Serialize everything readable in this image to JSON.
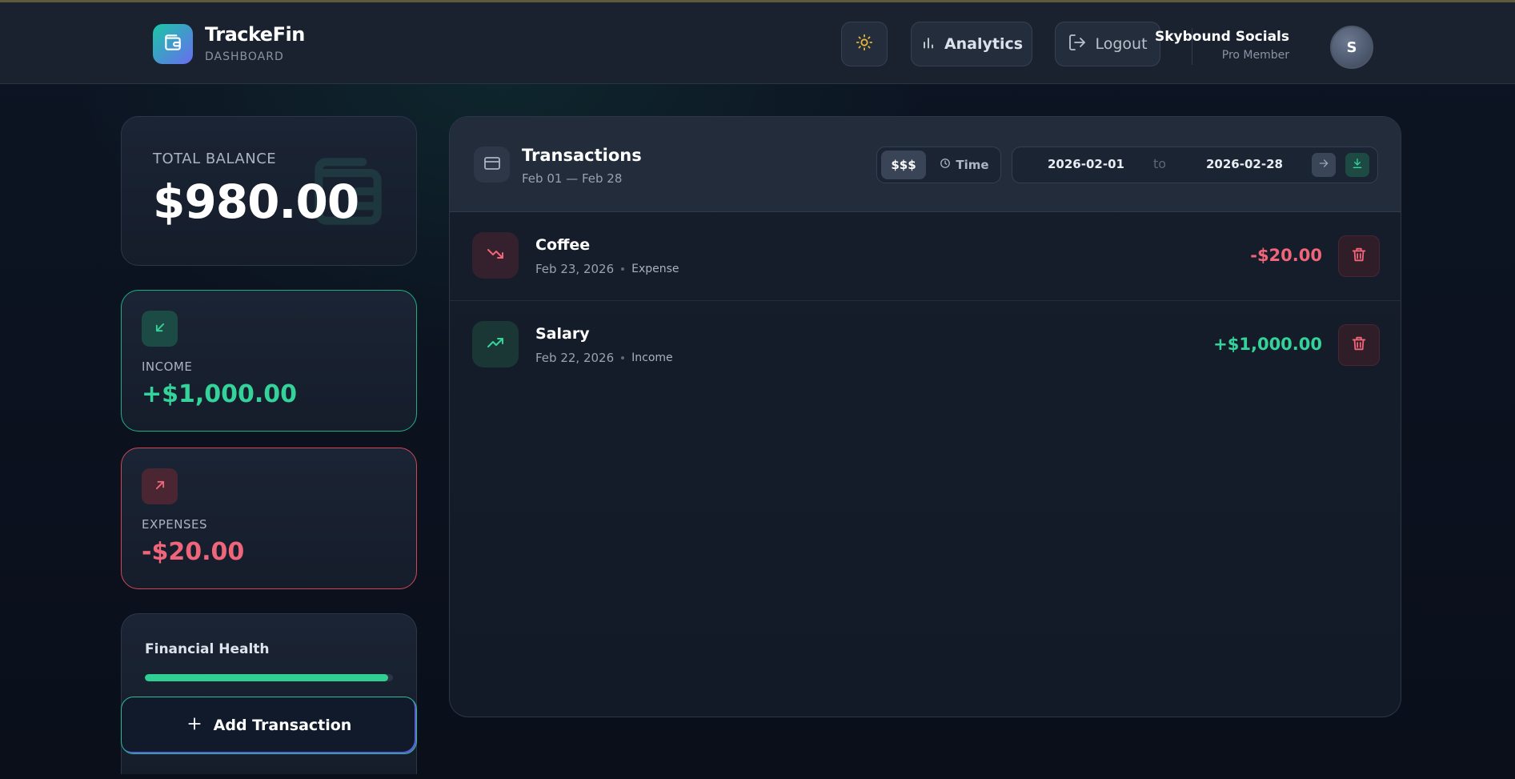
{
  "app": {
    "name": "TrackeFin",
    "section": "DASHBOARD"
  },
  "header": {
    "analytics_label": "Analytics",
    "logout_label": "Logout",
    "user_name": "Skybound Socials",
    "user_role": "Pro Member",
    "avatar_initial": "S"
  },
  "balance": {
    "label": "TOTAL BALANCE",
    "value": "$980.00"
  },
  "income": {
    "label": "INCOME",
    "value": "+$1,000.00"
  },
  "expenses": {
    "label": "EXPENSES",
    "value": "-$20.00"
  },
  "health": {
    "title": "Financial Health",
    "progress": 0.98
  },
  "add_button_label": "Add Transaction",
  "transactions": {
    "title": "Transactions",
    "range": "Feb 01 — Feb 28",
    "sort_amount_label": "$$$",
    "sort_time_label": "Time",
    "date_from": "2026-02-01",
    "date_to_word": "to",
    "date_to": "2026-02-28",
    "items": [
      {
        "name": "Coffee",
        "date": "Feb 23, 2026",
        "category": "Expense",
        "amount": "-$20.00"
      },
      {
        "name": "Salary",
        "date": "Feb 22, 2026",
        "category": "Income",
        "amount": "+$1,000.00"
      }
    ]
  },
  "colors": {
    "income": "#34d39a",
    "expense": "#f0657a",
    "accent_gradient_start": "#19c7a6",
    "accent_gradient_end": "#6a6cf0",
    "sun_icon": "#e8b53a"
  },
  "icons": {
    "logo": "wallet-icon",
    "theme": "sun-icon",
    "analytics": "bar-chart-icon",
    "logout": "logout-icon",
    "transactions": "credit-card-icon",
    "sort_time": "clock-icon",
    "apply": "arrow-right-icon",
    "download": "download-icon",
    "income": "arrow-down-left-icon",
    "expense": "arrow-up-right-icon",
    "trend_down": "trending-down-icon",
    "trend_up": "trending-up-icon",
    "delete": "trash-icon",
    "add": "plus-icon"
  }
}
